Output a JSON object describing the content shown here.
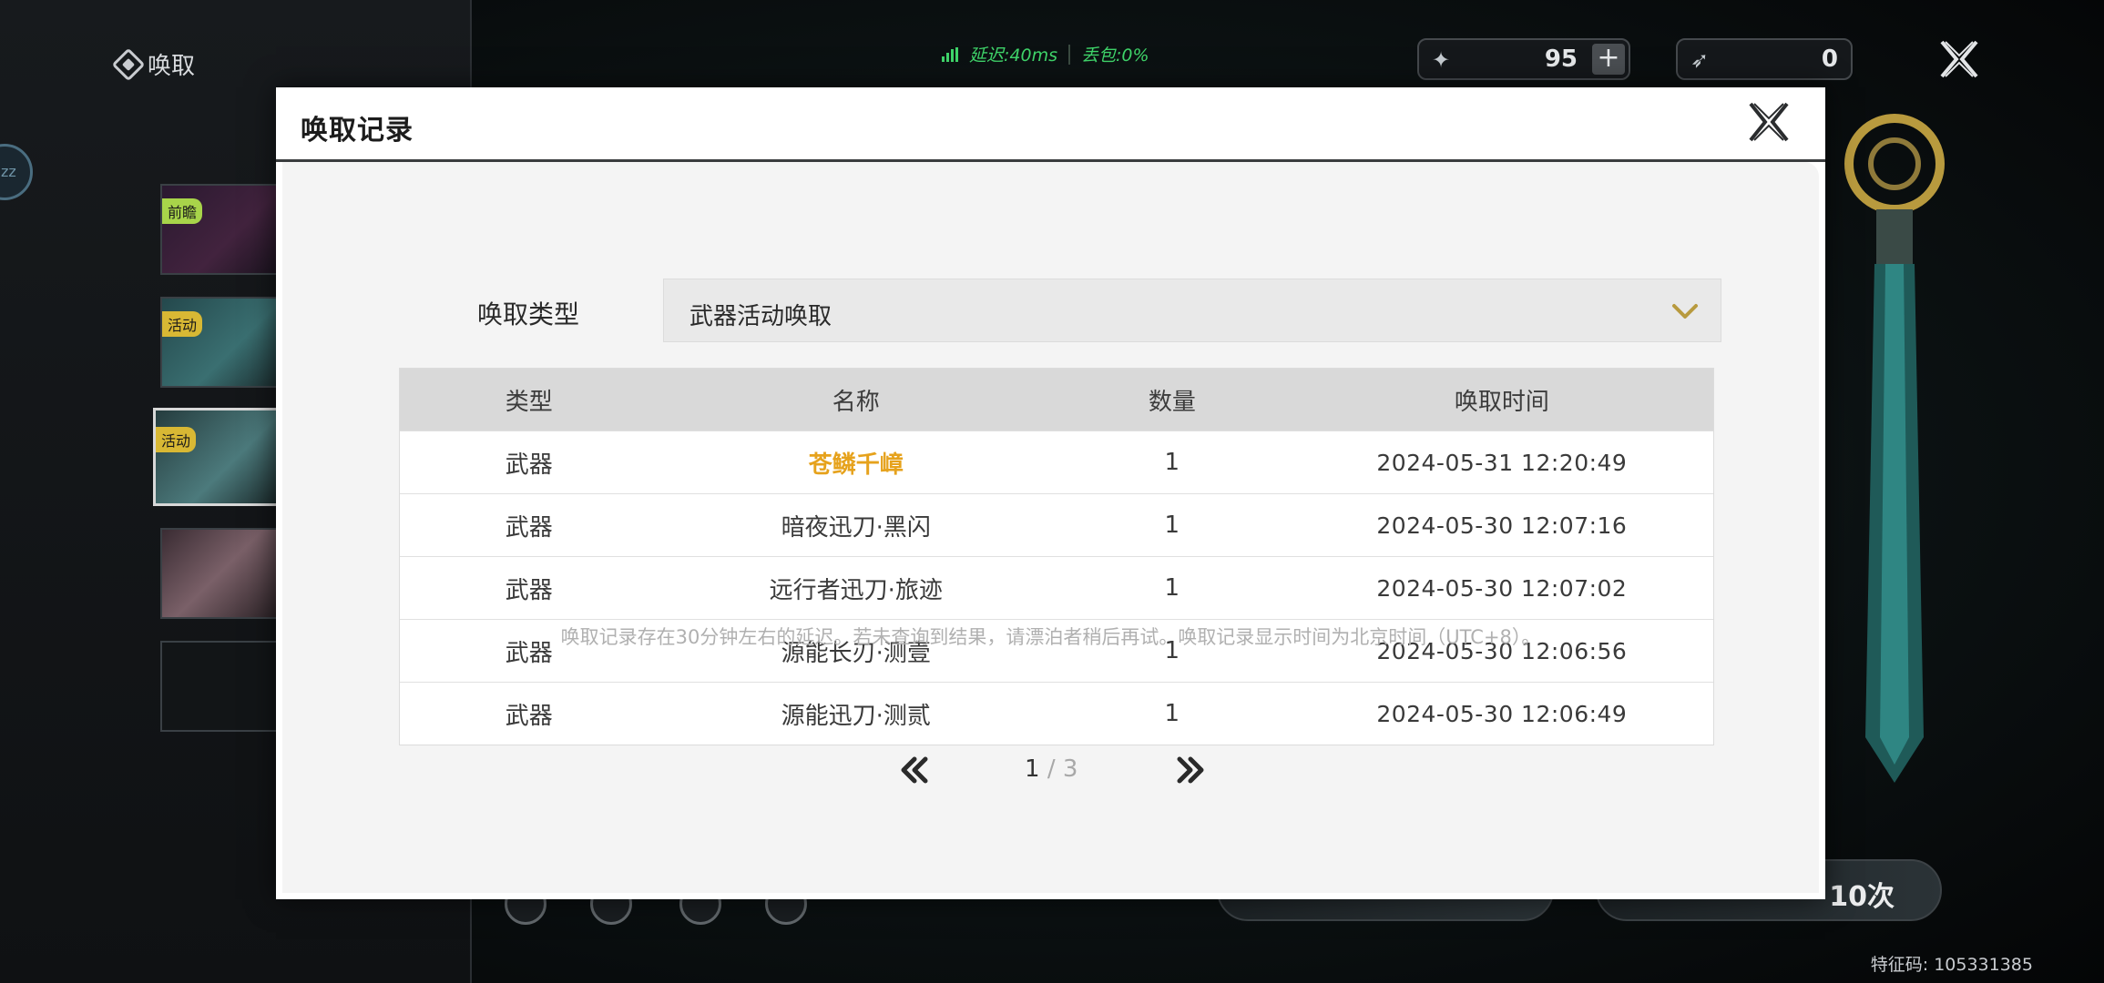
{
  "background": {
    "left_title": "唤取",
    "side_circle_text": "zz",
    "banner_tags": [
      "前瞻",
      "活动",
      "活动"
    ],
    "status": {
      "latency": "延迟:40ms",
      "packet_loss": "丢包:0%"
    },
    "currency_1": {
      "icon": "star-coin-icon",
      "value": "95",
      "plus": "+"
    },
    "currency_2": {
      "icon": "feather-icon",
      "value": "0"
    },
    "pull_ten_label": "10次",
    "feature_code": "特征码: 105331385"
  },
  "modal": {
    "title": "唤取记录",
    "type_label": "唤取类型",
    "type_selected": "武器活动唤取",
    "columns": [
      "类型",
      "名称",
      "数量",
      "唤取时间"
    ],
    "rows": [
      {
        "type": "武器",
        "name": "苍鳞千嶂",
        "qty": "1",
        "time": "2024-05-31 12:20:49",
        "highlight": true
      },
      {
        "type": "武器",
        "name": "暗夜迅刀·黑闪",
        "qty": "1",
        "time": "2024-05-30 12:07:16",
        "highlight": false
      },
      {
        "type": "武器",
        "name": "远行者迅刀·旅迹",
        "qty": "1",
        "time": "2024-05-30 12:07:02",
        "highlight": false
      },
      {
        "type": "武器",
        "name": "源能长刃·测壹",
        "qty": "1",
        "time": "2024-05-30 12:06:56",
        "highlight": false
      },
      {
        "type": "武器",
        "name": "源能迅刀·测贰",
        "qty": "1",
        "time": "2024-05-30 12:06:49",
        "highlight": false
      }
    ],
    "notice": "唤取记录存在30分钟左右的延迟。若未查询到结果，请漂泊者稍后再试。唤取记录显示时间为北京时间（UTC+8）。",
    "pager": {
      "current": "1",
      "total": "/ 3"
    }
  },
  "colors": {
    "highlight_name": "#e6a21c",
    "accent_gold": "#b89a3e",
    "status_green": "#3fd46a"
  }
}
